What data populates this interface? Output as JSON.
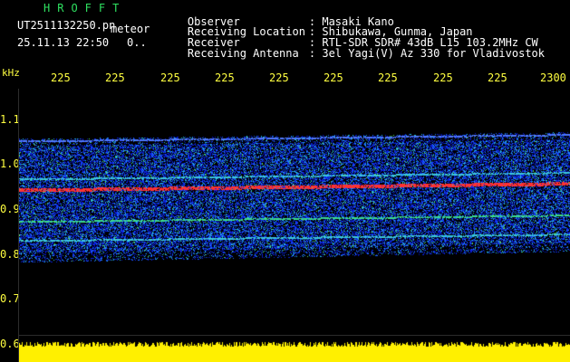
{
  "header": {
    "app_title": "HROFFT",
    "file_name": "UT2511132250.pn",
    "mode": "meteor",
    "timestamp": "25.11.13 22:50",
    "counter": "0.."
  },
  "station_info": [
    {
      "label": "Observer",
      "value": ": Masaki Kano"
    },
    {
      "label": "Receiving Location",
      "value": ": Shibukawa, Gunma, Japan"
    },
    {
      "label": "Receiver",
      "value": ": RTL-SDR SDR# 43dB L15 103.2MHz CW"
    },
    {
      "label": "Receiving Antenna",
      "value": ": 3el Yagi(V) Az 330 for Vladivostok"
    }
  ],
  "axes": {
    "y_unit": "kHz",
    "x_ticks": [
      "225",
      "225",
      "225",
      "225",
      "225",
      "225",
      "225",
      "225",
      "225",
      "2300"
    ],
    "y_ticks": [
      "1.1",
      "1.0",
      "0.9",
      "0.8",
      "0.7",
      "0.6"
    ]
  },
  "colors": {
    "background": "#000000",
    "title_green": "#2ee060",
    "tick_yellow": "#ffff40",
    "text_white": "#ffffff",
    "signal_red": "#ff3030",
    "noise_blue": "#1a2cff",
    "burst_yellow": "#ffff00"
  }
}
